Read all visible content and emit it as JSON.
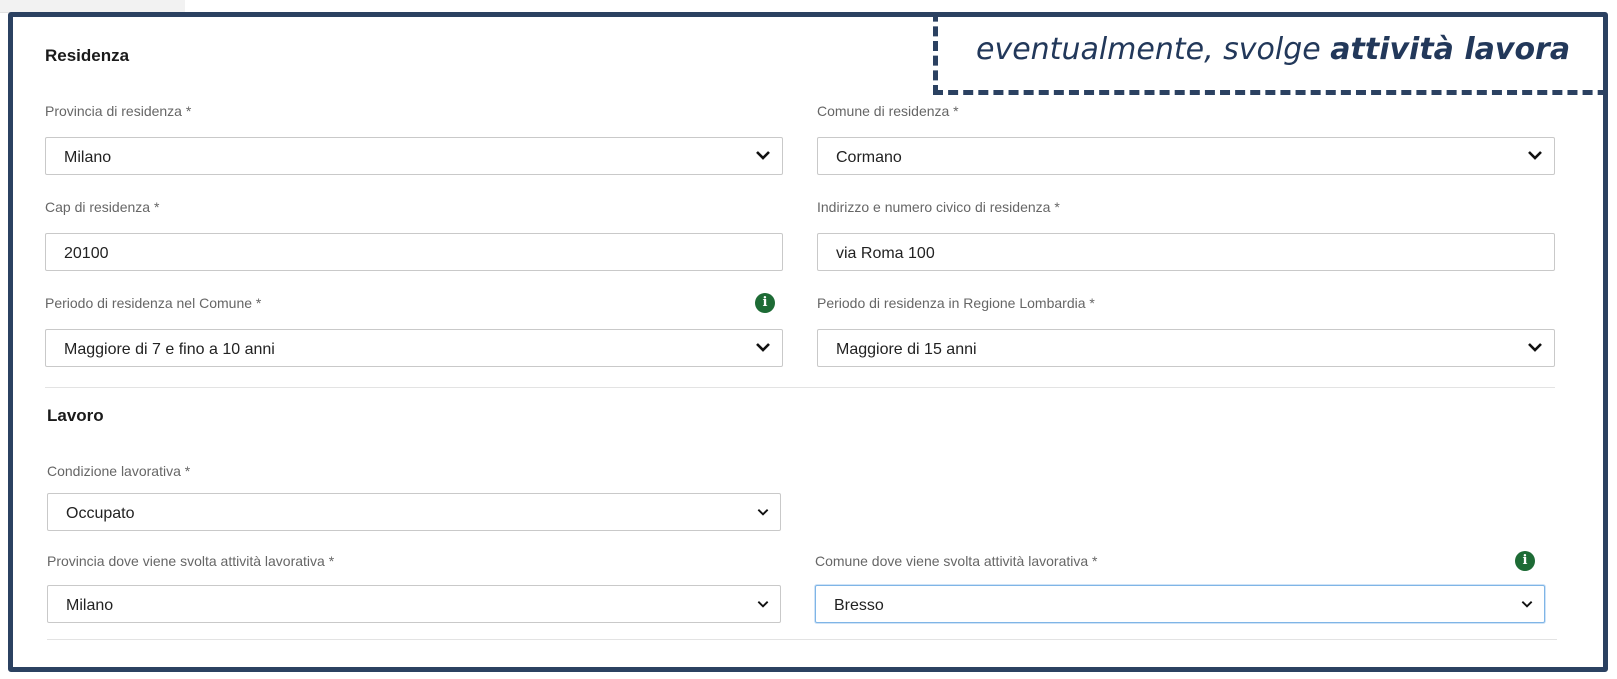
{
  "residenza": {
    "title": "Residenza",
    "provincia_label": "Provincia di residenza *",
    "provincia_value": "Milano",
    "comune_label": "Comune di residenza *",
    "comune_value": "Cormano",
    "cap_label": "Cap di residenza *",
    "cap_value": "20100",
    "indirizzo_label": "Indirizzo e numero civico di residenza *",
    "indirizzo_value": "via Roma 100",
    "periodo_comune_label": "Periodo di residenza nel Comune *",
    "periodo_comune_value": "Maggiore di 7 e fino a 10 anni",
    "periodo_regione_label": "Periodo di residenza in Regione Lombardia *",
    "periodo_regione_value": "Maggiore di 15 anni"
  },
  "lavoro": {
    "title": "Lavoro",
    "condizione_label": "Condizione lavorativa *",
    "condizione_value": "Occupato",
    "provincia_label": "Provincia dove viene svolta attività lavorativa *",
    "provincia_value": "Milano",
    "comune_label": "Comune dove viene svolta attività lavorativa *",
    "comune_value": "Bresso"
  },
  "callout": {
    "text_italic": "eventualmente, svolge ",
    "text_bold": "attività lavora"
  },
  "icons": {
    "info": "info-icon",
    "chevron": "chevron-down-icon"
  },
  "colors": {
    "frame": "#2b4161",
    "info_badge": "#1d6b35"
  }
}
